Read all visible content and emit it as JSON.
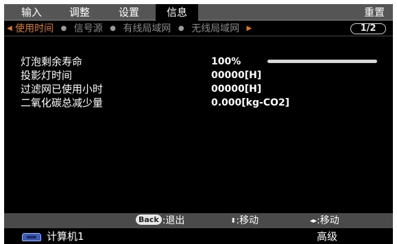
{
  "tabs": [
    {
      "label": "输入",
      "active": false
    },
    {
      "label": "调整",
      "active": false
    },
    {
      "label": "设置",
      "active": false
    },
    {
      "label": "信息",
      "active": true
    }
  ],
  "reset_label": "重置",
  "subtabs": {
    "items": [
      "使用时间",
      "信号源",
      "有线局域网",
      "无线局域网"
    ],
    "active_index": 0,
    "page_indicator": "1/2"
  },
  "info": [
    {
      "label": "灯泡剩余寿命",
      "value": "100%",
      "lamp_remaining_fraction": 1.0
    },
    {
      "label": "投影灯时间",
      "value": "00000[H]"
    },
    {
      "label": "过滤网已使用小时",
      "value": "00000[H]"
    },
    {
      "label": "二氧化碳总减少量",
      "value": "0.000[kg-CO2]"
    }
  ],
  "help": {
    "back_key": "Back",
    "back_text": ":退出",
    "updown_text": ":移动",
    "leftright_text": ":移动"
  },
  "source": {
    "icon": "computer-monitor-icon",
    "label": "计算机1",
    "mode": "高级"
  },
  "colors": {
    "accent": "#e07a1f",
    "tab_bar": "#555555",
    "help_bar": "#4a4a4a",
    "background": "#000000"
  }
}
